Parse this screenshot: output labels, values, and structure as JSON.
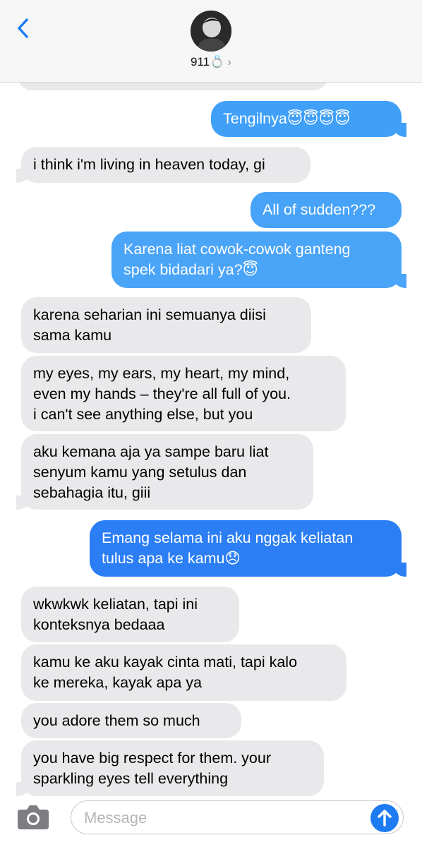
{
  "header": {
    "contact_name": "911💍",
    "chevron": "›",
    "back_icon": "chevron-left-icon",
    "avatar_icon": "contact-avatar"
  },
  "messages": [
    {
      "dir": "recv",
      "text": ""
    },
    {
      "dir": "sent",
      "text": "Tengilnya😇😇😇😇"
    },
    {
      "dir": "recv",
      "text": "i think i'm living in heaven today, gi"
    },
    {
      "dir": "sent",
      "text": "All of sudden???"
    },
    {
      "dir": "sent",
      "text": "Karena liat cowok-cowok ganteng\nspek bidadari ya?😇"
    },
    {
      "dir": "recv",
      "text": "karena seharian ini semuanya diisi\nsama kamu"
    },
    {
      "dir": "recv",
      "text": "my eyes, my ears, my heart, my mind,\neven my hands – they're all full of you.\ni can't see anything else, but you"
    },
    {
      "dir": "recv",
      "text": "aku kemana aja ya sampe baru liat\nsenyum kamu yang setulus dan\nsebahagia itu, giii"
    },
    {
      "dir": "sent",
      "text": "Emang selama ini aku nggak keliatan\ntulus apa ke kamu😞"
    },
    {
      "dir": "recv",
      "text": "wkwkwk keliatan, tapi ini\nkonteksnya bedaaa"
    },
    {
      "dir": "recv",
      "text": "kamu ke aku kayak cinta mati, tapi kalo\nke mereka, kayak apa ya"
    },
    {
      "dir": "recv",
      "text": "you adore them so much"
    },
    {
      "dir": "recv",
      "text": "you have big respect for them. your\nsparkling eyes tell everything"
    }
  ],
  "composer": {
    "placeholder": "Message",
    "camera_icon": "camera-icon",
    "send_icon": "arrow-up-icon"
  },
  "colors": {
    "sent_top": "#3f9cf7",
    "sent_bottom": "#1d6ff2",
    "received": "#e9e9eb",
    "accent": "#1e7cf2"
  }
}
